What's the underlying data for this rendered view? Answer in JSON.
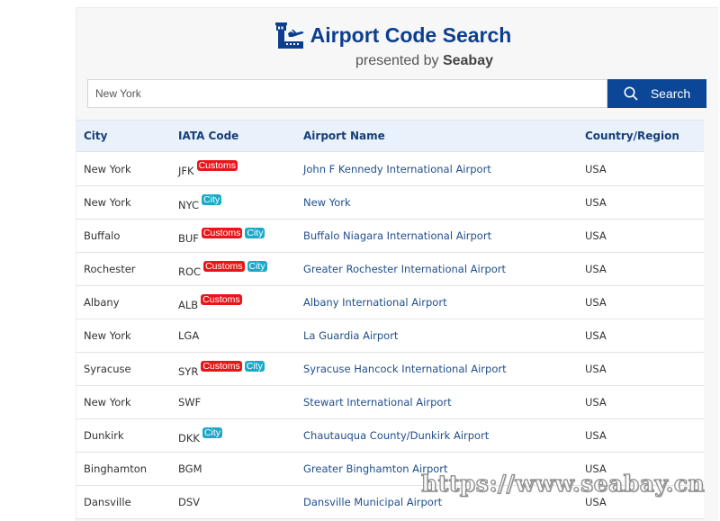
{
  "header": {
    "title": "Airport Code Search",
    "subtitle_prefix": "presented by ",
    "subtitle_brand": "Seabay",
    "icon": "airport-tower-icon"
  },
  "search": {
    "value": "New York",
    "placeholder": "",
    "button_label": "Search",
    "button_icon": "search-icon"
  },
  "colors": {
    "brand": "#0b4697",
    "title": "#0d3e8e",
    "customs_badge": "#e8161b",
    "city_badge": "#1ba9c8",
    "link": "#1f4e8c",
    "header_bg": "#e9f2fb"
  },
  "table": {
    "columns": [
      "City",
      "IATA Code",
      "Airport Name",
      "Country/Region"
    ],
    "rows": [
      {
        "city": "New York",
        "code": "JFK",
        "customs": "Customs",
        "citybadge": null,
        "name": "John F Kennedy International Airport",
        "country": "USA"
      },
      {
        "city": "New York",
        "code": "NYC",
        "customs": null,
        "citybadge": "City",
        "name": "New York",
        "country": "USA"
      },
      {
        "city": "Buffalo",
        "code": "BUF",
        "customs": "Customs",
        "citybadge": "City",
        "name": "Buffalo Niagara International Airport",
        "country": "USA"
      },
      {
        "city": "Rochester",
        "code": "ROC",
        "customs": "Customs",
        "citybadge": "City",
        "name": "Greater Rochester International Airport",
        "country": "USA"
      },
      {
        "city": "Albany",
        "code": "ALB",
        "customs": "Customs",
        "citybadge": null,
        "name": "Albany International Airport",
        "country": "USA"
      },
      {
        "city": "New York",
        "code": "LGA",
        "customs": null,
        "citybadge": null,
        "name": "La Guardia Airport",
        "country": "USA"
      },
      {
        "city": "Syracuse",
        "code": "SYR",
        "customs": "Customs",
        "citybadge": "City",
        "name": "Syracuse Hancock International Airport",
        "country": "USA"
      },
      {
        "city": "New York",
        "code": "SWF",
        "customs": null,
        "citybadge": null,
        "name": "Stewart International Airport",
        "country": "USA"
      },
      {
        "city": "Dunkirk",
        "code": "DKK",
        "customs": null,
        "citybadge": "City",
        "name": "Chautauqua County/Dunkirk Airport",
        "country": "USA"
      },
      {
        "city": "Binghamton",
        "code": "BGM",
        "customs": null,
        "citybadge": null,
        "name": "Greater Binghamton Airport",
        "country": "USA"
      },
      {
        "city": "Dansville",
        "code": "DSV",
        "customs": null,
        "citybadge": null,
        "name": "Dansville Municipal Airport",
        "country": "USA"
      }
    ]
  },
  "watermark": "https://www.seabay.cn"
}
